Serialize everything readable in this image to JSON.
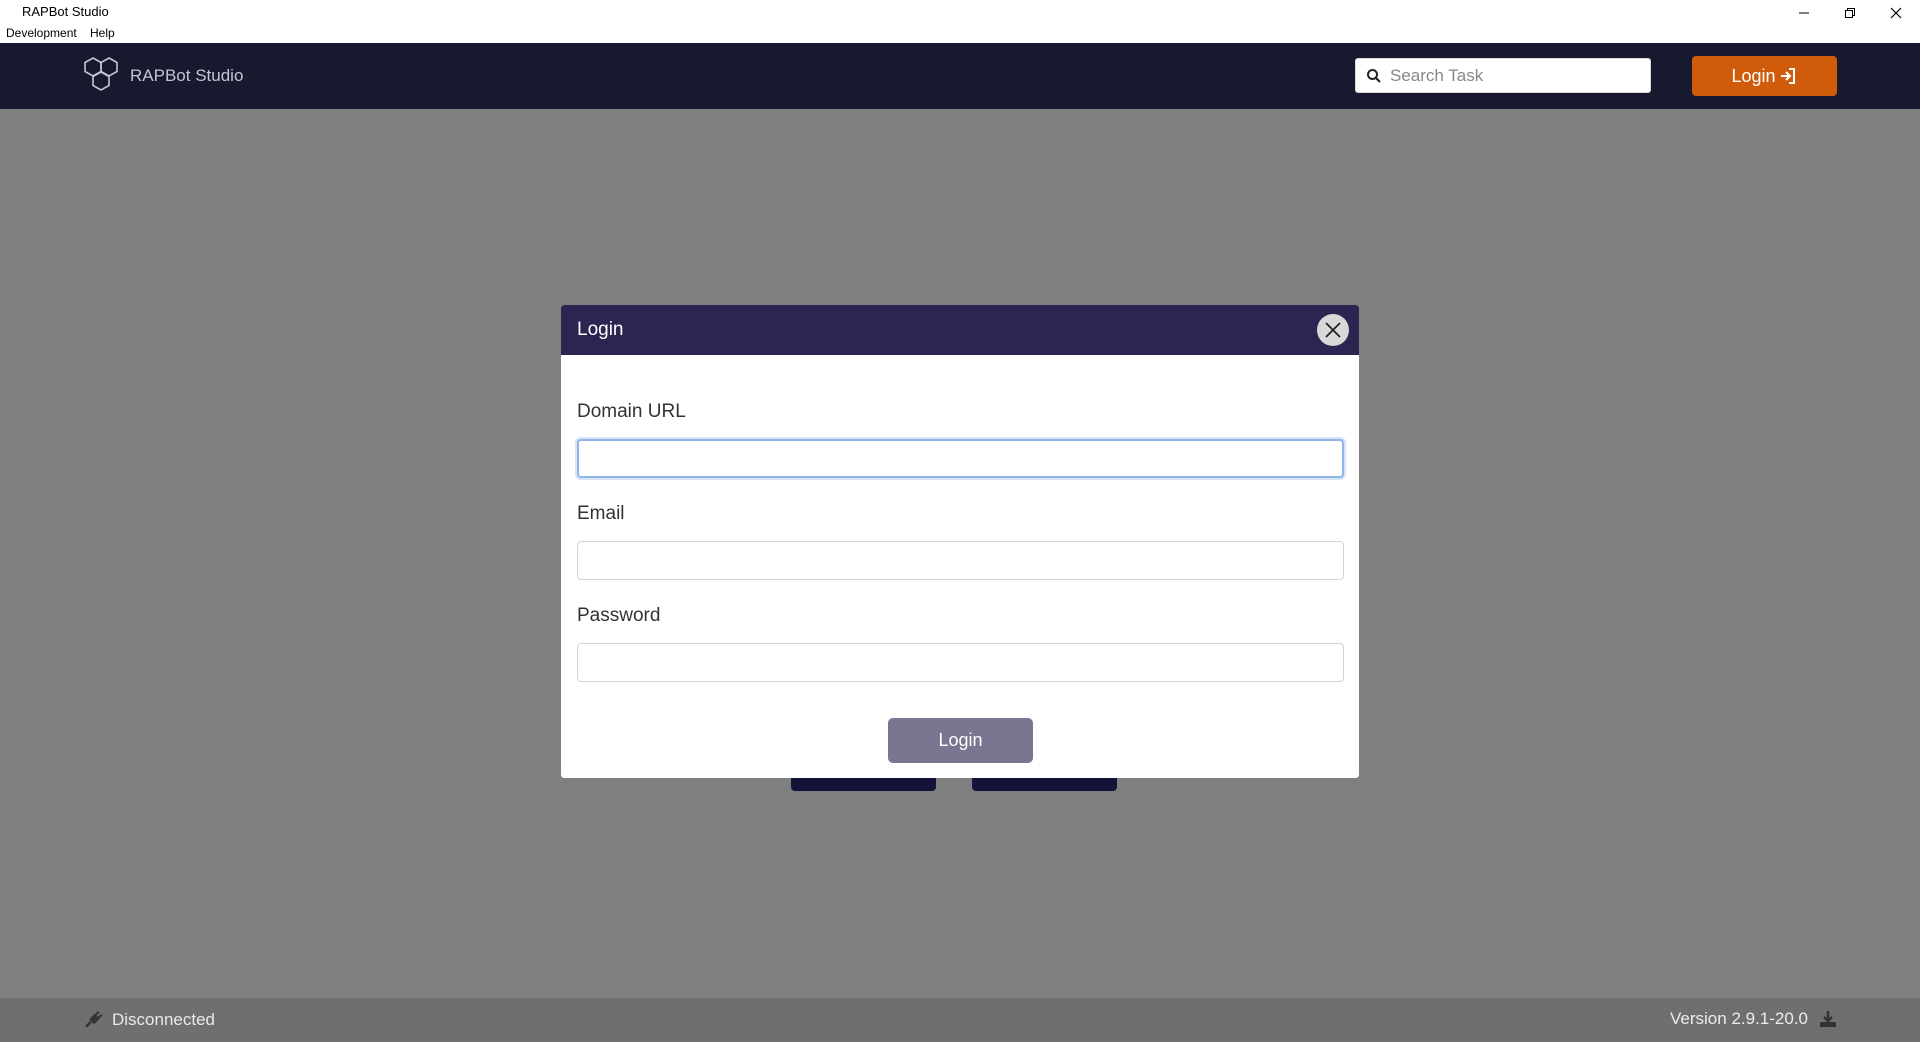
{
  "window": {
    "title": "RAPBot Studio"
  },
  "menu": {
    "items": [
      "Development",
      "Help"
    ]
  },
  "header": {
    "brand": "RAPBot Studio",
    "search_placeholder": "Search Task",
    "login_label": "Login"
  },
  "modal": {
    "title": "Login",
    "fields": [
      {
        "label": "Domain URL",
        "value": ""
      },
      {
        "label": "Email",
        "value": ""
      },
      {
        "label": "Password",
        "value": ""
      }
    ],
    "submit_label": "Login"
  },
  "status": {
    "connection": "Disconnected",
    "version": "Version 2.9.1-20.0"
  },
  "colors": {
    "header_bg": "#18182f",
    "modal_header_bg": "#2c2552",
    "login_button": "#d05c0b",
    "submit_button": "#7b7592"
  },
  "icons": [
    "hexagon-logo-icon",
    "search-icon",
    "login-arrow-icon",
    "close-icon",
    "plug-icon",
    "download-icon",
    "minimize-icon",
    "restore-icon",
    "window-close-icon"
  ]
}
